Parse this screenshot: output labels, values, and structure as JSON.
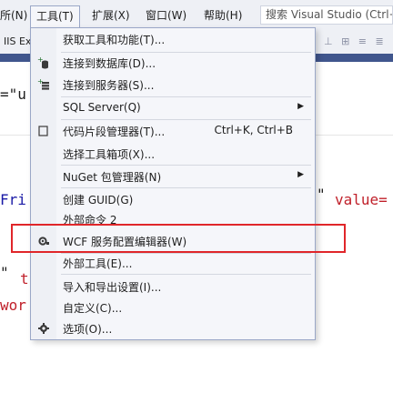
{
  "menubar": {
    "items": [
      {
        "label": "所(N)"
      },
      {
        "label": "工具(T)"
      },
      {
        "label": "扩展(X)"
      },
      {
        "label": "窗口(W)"
      },
      {
        "label": "帮助(H)"
      }
    ],
    "search_text": "搜索 Visual Studio (Ctrl+"
  },
  "toolbar": {
    "left_text": "IIS Ex",
    "right_icons": "⊥ ⊞ ≡ ≣"
  },
  "editor": {
    "line1": "=\"u",
    "line2a": "Fri",
    "line2b": "\"",
    "line2c": "value=",
    "line3a": "\"",
    "line3b": "t",
    "line4": "wor"
  },
  "dropdown": {
    "items": [
      {
        "label": "获取工具和功能(T)...",
        "icon": ""
      },
      {
        "label": "连接到数据库(D)...",
        "icon": "database-plus-icon"
      },
      {
        "label": "连接到服务器(S)...",
        "icon": "server-plus-icon"
      },
      {
        "label": "SQL Server(Q)",
        "icon": "",
        "submenu": true
      },
      {
        "label": "代码片段管理器(T)...",
        "icon": "snippet-icon",
        "shortcut": "Ctrl+K, Ctrl+B"
      },
      {
        "label": "选择工具箱项(X)...",
        "icon": ""
      },
      {
        "label": "NuGet 包管理器(N)",
        "icon": "",
        "submenu": true
      },
      {
        "label": "创建 GUID(G)",
        "icon": ""
      },
      {
        "label": "外部命令 2",
        "icon": ""
      },
      {
        "label": "WCF 服务配置编辑器(W)",
        "icon": "wcf-gear-icon"
      },
      {
        "label": "外部工具(E)...",
        "icon": ""
      },
      {
        "label": "导入和导出设置(I)...",
        "icon": ""
      },
      {
        "label": "自定义(C)...",
        "icon": ""
      },
      {
        "label": "选项(O)...",
        "icon": "gear-icon"
      }
    ]
  },
  "colors": {
    "menubar_bg": "#eef0f5",
    "toolbar_strip": "#40568d",
    "highlight_border": "#e0262a",
    "code_blue": "#1a1aa6",
    "code_red": "#c0202a"
  }
}
